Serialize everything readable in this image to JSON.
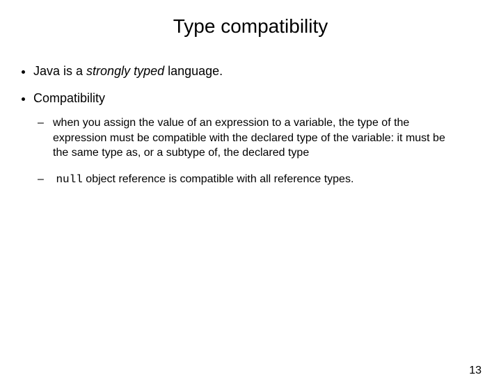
{
  "slide": {
    "title": "Type compatibility",
    "bullet1_pre": "Java is a ",
    "bullet1_em": "strongly typed",
    "bullet1_post": " language.",
    "bullet2": "Compatibility",
    "sub1": "when you assign the value of an expression to a variable, the type of the expression must be compatible with the declared type of the variable: it must be the same type as, or a subtype of, the declared type",
    "sub2_code": "null",
    "sub2_rest": " object reference is compatible with all reference types.",
    "page_number": "13"
  }
}
